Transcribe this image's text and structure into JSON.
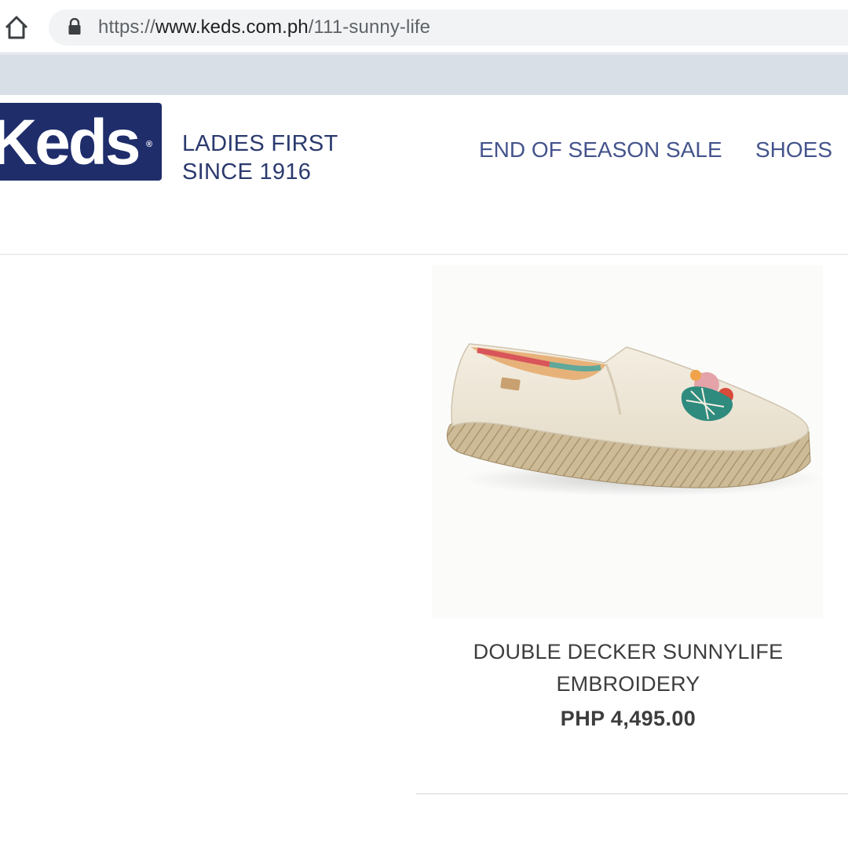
{
  "browser": {
    "url_scheme": "https://",
    "url_host": "www.keds.com.ph",
    "url_path": "/111-sunny-life"
  },
  "site": {
    "logo_text": "Keds",
    "tagline_line1": "LADIES FIRST",
    "tagline_line2": "SINCE 1916",
    "brand_color": "#1f2d6b",
    "nav": [
      {
        "label": "END OF SEASON SALE"
      },
      {
        "label": "SHOES"
      }
    ]
  },
  "product": {
    "name_line1": "DOUBLE DECKER SUNNYLIFE",
    "name_line2": "EMBROIDERY",
    "price": "PHP 4,495.00",
    "image_icon": "slip-on-espadrille-shoe-image"
  }
}
